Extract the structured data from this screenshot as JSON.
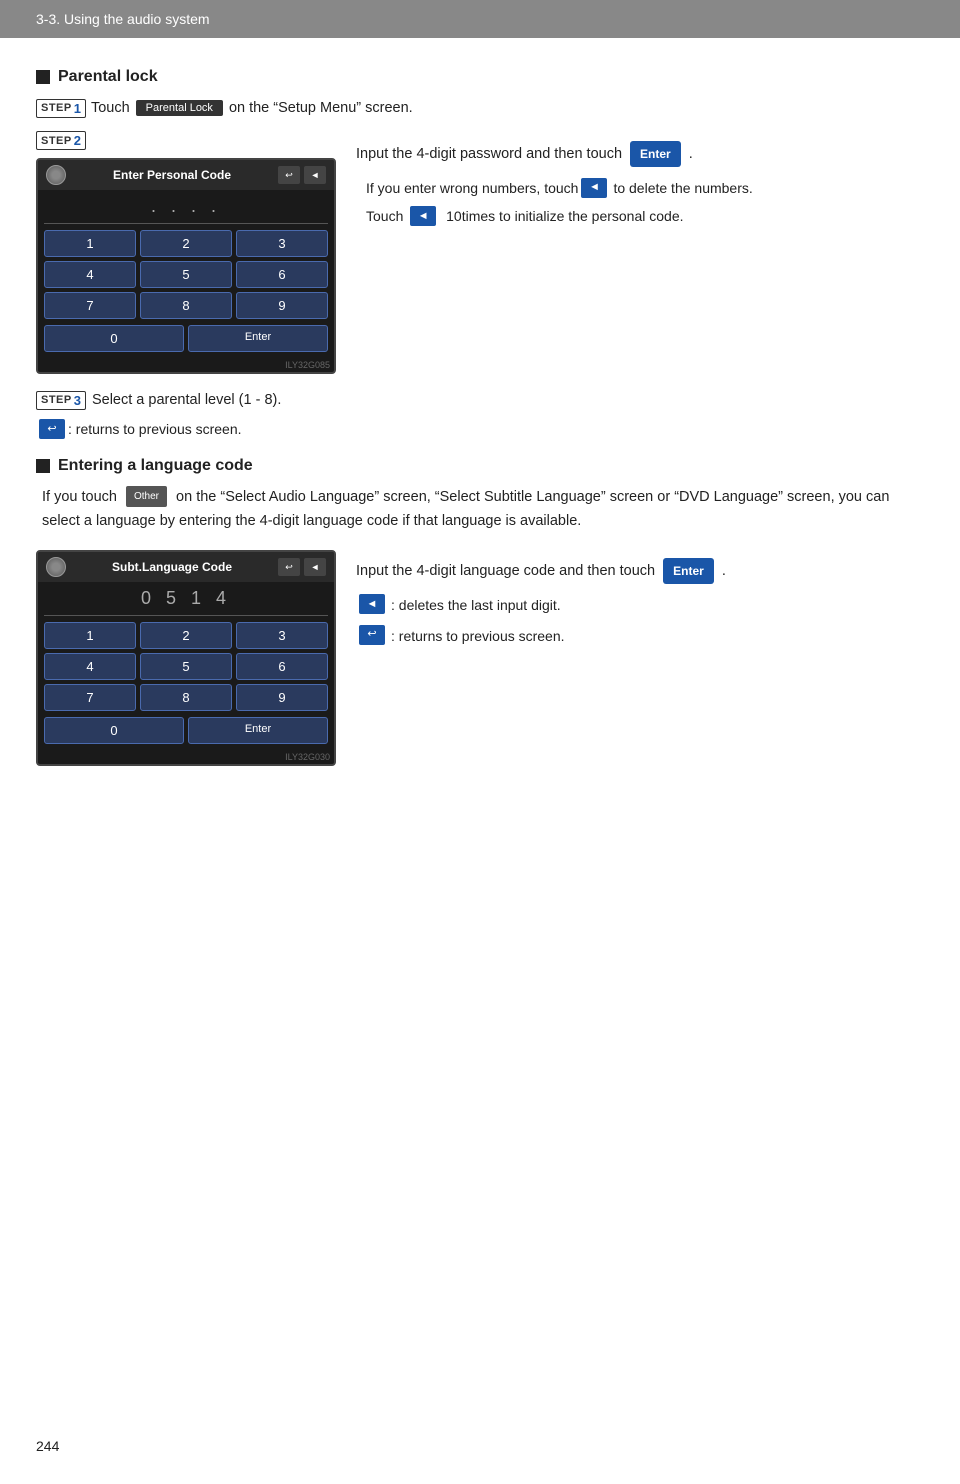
{
  "header": {
    "title": "3-3. Using the audio system"
  },
  "page_number": "244",
  "section1": {
    "title": "Parental lock",
    "step1": {
      "label": "STEP",
      "number": "1",
      "text_before": "Touch",
      "button_label": "Parental Lock",
      "text_after": "on the “Setup Menu” screen."
    },
    "step2": {
      "label": "STEP",
      "number": "2",
      "screen": {
        "title": "Enter Personal Code",
        "dots": ". . . .",
        "keys": [
          "1",
          "2",
          "3",
          "4",
          "5",
          "6",
          "7",
          "8",
          "9",
          "0",
          "Enter"
        ],
        "watermark": "ILY32G085"
      },
      "text_main": "Input  the  4-digit  password  and then touch",
      "enter_label": "Enter",
      "note1_pre": "If you enter wrong numbers, touch",
      "note1_post": "to delete the numbers.",
      "note2_pre": "Touch",
      "note2_num": "10",
      "note2_post": "times to initialize the personal code."
    },
    "step3": {
      "label": "STEP",
      "number": "3",
      "text": "Select a parental level (1 - 8)."
    },
    "return_note": {
      "icon_label": "↺",
      "text": ":   returns to previous screen."
    }
  },
  "section2": {
    "title": "Entering a language code",
    "body": "If you touch",
    "other_label": "Other",
    "body2": " on the “Select Audio Language” screen, “Select Subtitle Language” screen or “DVD Language” screen, you can select a language by entering the 4-digit language code if that language is available.",
    "screen": {
      "title": "Subt.Language Code",
      "value": "0 5 1 4",
      "keys": [
        "1",
        "2",
        "3",
        "4",
        "5",
        "6",
        "7",
        "8",
        "9",
        "0",
        "Enter"
      ],
      "watermark": "ILY32G030"
    },
    "text_main": "Input  the  4-digit  language  code and then touch",
    "enter_label": "Enter",
    "note1_pre": "",
    "note1_colon": ":   deletes the last input digit.",
    "note2_colon": ":   returns      to      previous screen."
  }
}
